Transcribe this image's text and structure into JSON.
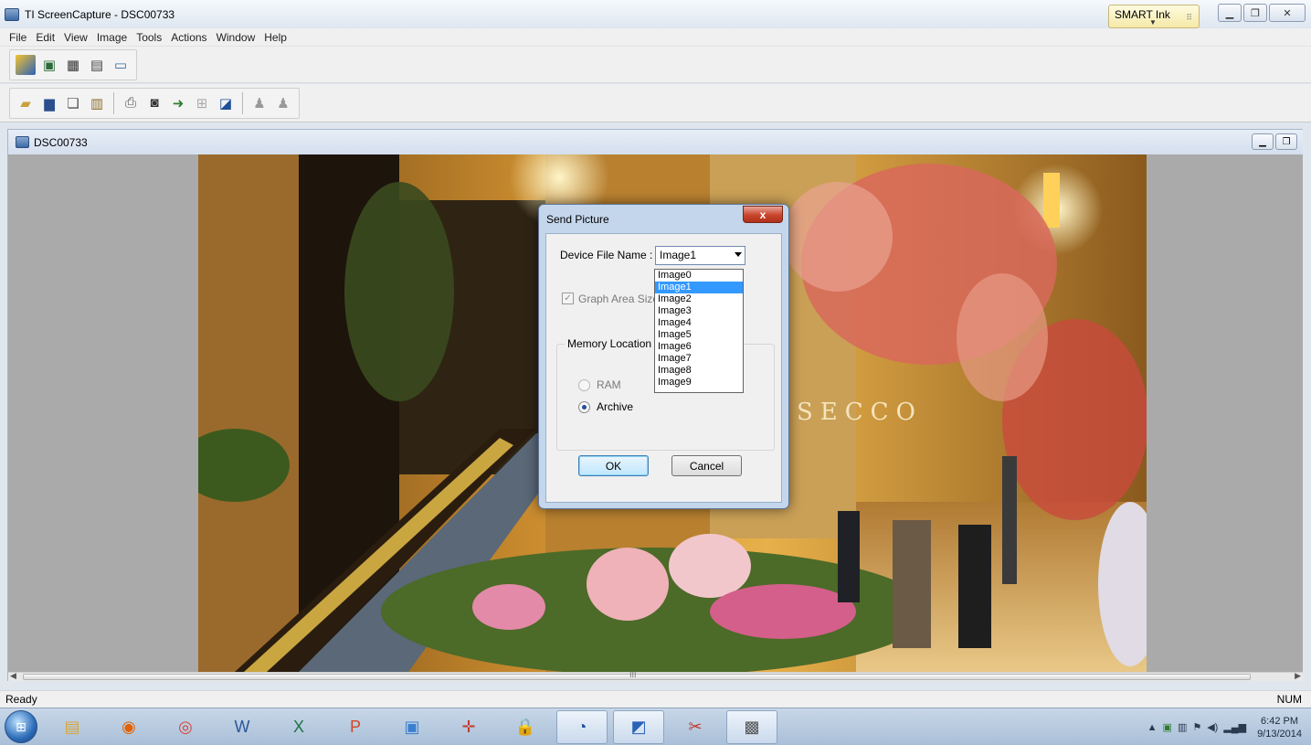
{
  "window": {
    "title": "TI ScreenCapture - DSC00733",
    "smart_ink": "SMART Ink"
  },
  "menu": [
    "File",
    "Edit",
    "View",
    "Image",
    "Tools",
    "Actions",
    "Window",
    "Help"
  ],
  "toolbar1": {
    "icons": [
      "ti-logo-icon",
      "screen-capture-icon",
      "filmstrip-icon",
      "calculator-icon",
      "picture-icon"
    ]
  },
  "toolbar2": {
    "icons": [
      "open-folder-icon",
      "save-icon",
      "copy-icon",
      "paste-icon",
      "print-icon",
      "camera-icon",
      "send-to-calculator-icon",
      "grid-icon",
      "edit-icon",
      "user-icon",
      "users-icon"
    ]
  },
  "mdi": {
    "title": "DSC00733"
  },
  "dialog": {
    "title": "Send Picture",
    "close_label": "x",
    "device_file_label": "Device File Name :",
    "combo_value": "Image1",
    "graph_area_label": "Graph Area Size",
    "memory_label": "Memory Location",
    "ram_label": "RAM",
    "archive_label": "Archive",
    "ok_label": "OK",
    "cancel_label": "Cancel"
  },
  "dropdown": {
    "options": [
      "Image0",
      "Image1",
      "Image2",
      "Image3",
      "Image4",
      "Image5",
      "Image6",
      "Image7",
      "Image8",
      "Image9"
    ],
    "selected_index": 1
  },
  "status": {
    "left": "Ready",
    "right": "NUM"
  },
  "scrollbar": {
    "grip": "III"
  },
  "taskbar": {
    "apps": [
      "explorer-icon",
      "firefox-icon",
      "chrome-icon",
      "word-icon",
      "excel-icon",
      "powerpoint-icon",
      "notepad-icon",
      "crosshair-icon",
      "lock-icon",
      "clock-app-icon",
      "ti-screencapture-icon",
      "snipping-tool-icon",
      "paint-icon"
    ],
    "time": "6:42 PM",
    "date": "9/13/2014"
  },
  "photo": {
    "sign_text": "SECCO"
  }
}
